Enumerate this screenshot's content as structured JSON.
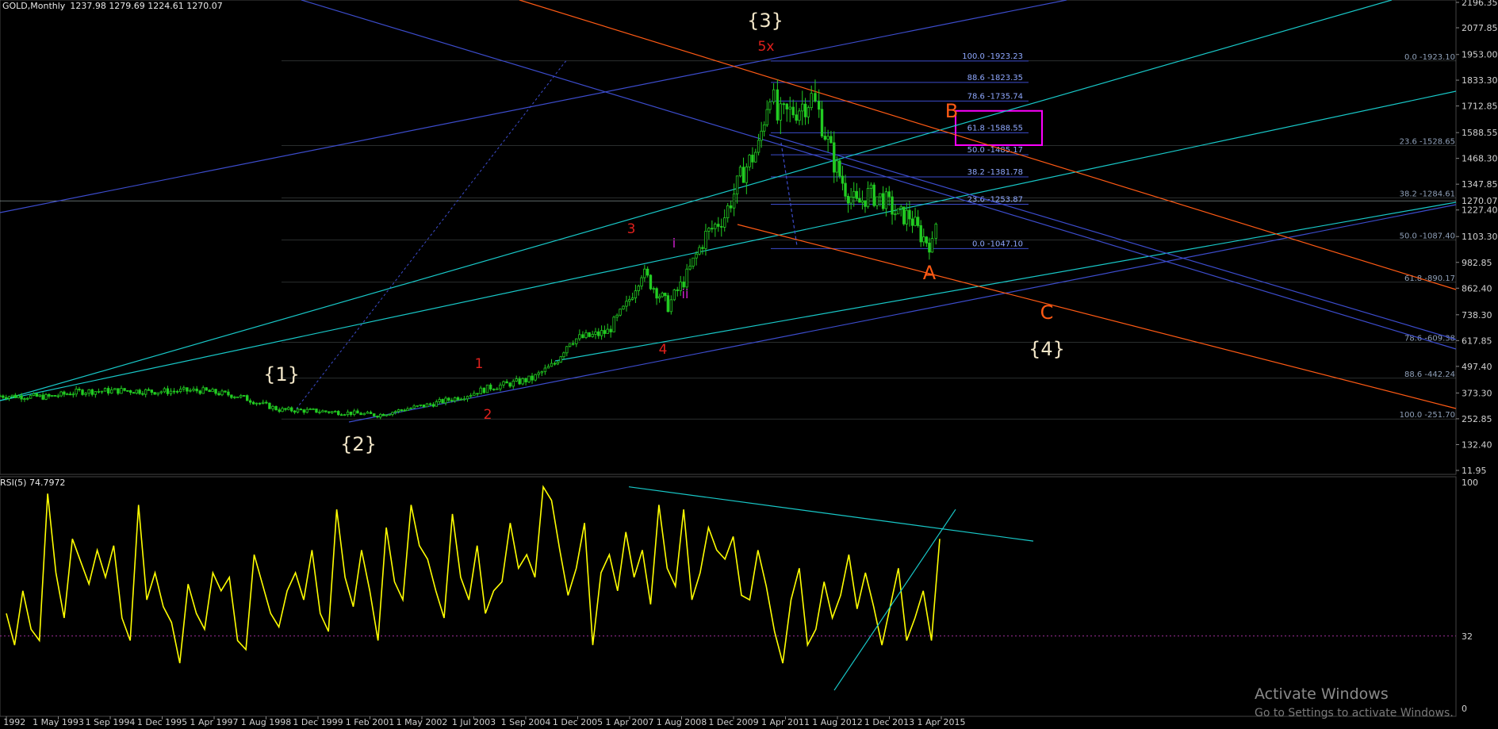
{
  "window": {
    "symbol_header": "GOLD,Monthly",
    "ohlc": "1237.98 1279.69 1224.61 1270.07"
  },
  "chart_data": [
    {
      "type": "candlestick",
      "name": "price-panel",
      "title": "GOLD,Monthly",
      "y_ticks": [
        "2196.35",
        "2077.85",
        "1953.00",
        "1833.30",
        "1712.85",
        "1588.55",
        "1468.30",
        "1347.85",
        "1227.40",
        "1103.30",
        "982.85",
        "862.40",
        "738.30",
        "617.85",
        "497.40",
        "373.30",
        "252.85",
        "132.40",
        "11.95"
      ],
      "last_price": "1270.07",
      "price_path": {
        "note_units": "date-year / USD",
        "x_years": [
          1991.2,
          1992.5,
          1993.3,
          1994.5,
          1995.3,
          1996.5,
          1997.5,
          1998.0,
          1998.6,
          1999.5,
          2000.5,
          2001.2,
          2002.0,
          2002.6,
          2003.5,
          2004.2,
          2004.8,
          2005.3,
          2005.9,
          2006.3,
          2006.9,
          2007.3,
          2007.8,
          2008.2,
          2008.6,
          2008.9,
          2009.4,
          2009.9,
          2010.4,
          2010.9,
          2011.3,
          2011.6,
          2011.8,
          2012.3,
          2012.7,
          2012.9,
          2013.3,
          2013.6,
          2013.9,
          2014.2,
          2014.6,
          2015.0,
          2015.3,
          2015.6,
          2015.9,
          2016.1
        ],
        "y_close": [
          360,
          355,
          380,
          385,
          380,
          385,
          360,
          330,
          295,
          290,
          280,
          270,
          300,
          320,
          360,
          400,
          420,
          440,
          510,
          620,
          640,
          660,
          780,
          940,
          850,
          780,
          920,
          1110,
          1200,
          1410,
          1520,
          1800,
          1650,
          1700,
          1750,
          1680,
          1450,
          1330,
          1250,
          1300,
          1280,
          1200,
          1200,
          1110,
          1060,
          1270
        ]
      },
      "fib_right": [
        {
          "label": "0.0 -1923.10",
          "price": 1923
        },
        {
          "label": "23.6 -1528.65",
          "price": 1528
        },
        {
          "label": "38.2 -1284.61",
          "price": 1284
        },
        {
          "label": "50.0 -1087.40",
          "price": 1087
        },
        {
          "label": "61.8 -890.17",
          "price": 890
        },
        {
          "label": "78.6 -609.38",
          "price": 609
        },
        {
          "label": "88.6 -442.24",
          "price": 442
        },
        {
          "label": "100.0 -251.70",
          "price": 252
        }
      ],
      "fib_inner": [
        {
          "label": "100.0 -1923.23",
          "price": 1923
        },
        {
          "label": "88.6 -1823.35",
          "price": 1823
        },
        {
          "label": "78.6 -1735.74",
          "price": 1736
        },
        {
          "label": "61.8 -1588.55",
          "price": 1588
        },
        {
          "label": "50.0 -1485.17",
          "price": 1485
        },
        {
          "label": "38.2 -1381.78",
          "price": 1382
        },
        {
          "label": "23.6 -1253.87",
          "price": 1254
        },
        {
          "label": "0.0 -1047.10",
          "price": 1047
        }
      ],
      "wave_labels": [
        {
          "text": "{1}",
          "color": "#f2e6c8"
        },
        {
          "text": "{2}",
          "color": "#f2e6c8"
        },
        {
          "text": "{3}",
          "color": "#f2e6c8"
        },
        {
          "text": "{4}",
          "color": "#f2e6c8"
        },
        {
          "text": "1",
          "color": "#e0201c"
        },
        {
          "text": "2",
          "color": "#e0201c"
        },
        {
          "text": "3",
          "color": "#e0201c"
        },
        {
          "text": "4",
          "color": "#e0201c"
        },
        {
          "text": "5x",
          "color": "#e0201c"
        },
        {
          "text": "i",
          "color": "#d020d0"
        },
        {
          "text": "ii",
          "color": "#d020d0"
        },
        {
          "text": "A",
          "color": "#ff5a14"
        },
        {
          "text": "B",
          "color": "#ff5a14"
        },
        {
          "text": "C",
          "color": "#ff5a14"
        }
      ],
      "colors": {
        "candles": "#22cc22",
        "channel_cyan": "#18c8c8",
        "channel_blue": "#3c4ccc",
        "channel_orange": "#ff5a14",
        "fib": "#3c4ccc",
        "highlight_box": "#ff00ff"
      }
    },
    {
      "type": "line",
      "name": "rsi-panel",
      "header": "RSI(5) 74.7972",
      "y_ticks": [
        "100",
        "32",
        "0"
      ],
      "level": 32,
      "series_color": "#ffff00",
      "values": [
        42,
        28,
        52,
        35,
        30,
        95,
        60,
        40,
        75,
        65,
        55,
        70,
        58,
        72,
        40,
        30,
        90,
        48,
        60,
        45,
        38,
        20,
        55,
        42,
        35,
        60,
        52,
        58,
        30,
        26,
        68,
        55,
        42,
        36,
        52,
        60,
        48,
        70,
        42,
        34,
        88,
        58,
        45,
        70,
        52,
        30,
        80,
        56,
        48,
        90,
        72,
        66,
        52,
        40,
        86,
        58,
        48,
        72,
        42,
        52,
        56,
        82,
        62,
        68,
        58,
        98,
        92,
        70,
        50,
        62,
        82,
        28,
        60,
        68,
        52,
        78,
        58,
        70,
        46,
        90,
        62,
        54,
        88,
        48,
        60,
        80,
        70,
        66,
        76,
        50,
        48,
        70,
        54,
        34,
        20,
        48,
        62,
        28,
        35,
        56,
        40,
        50,
        68,
        44,
        60,
        45,
        28,
        45,
        62,
        30,
        40,
        52,
        30,
        75
      ],
      "date_labels": [
        "Jan 1992",
        "1 May 1993",
        "1 Sep 1994",
        "1 Dec 1995",
        "1 Apr 1997",
        "1 Aug 1998",
        "1 Dec 1999",
        "1 Feb 2001",
        "1 May 2002",
        "1 Jul 2003",
        "1 Sep 2004",
        "1 Dec 2005",
        "1 Apr 2007",
        "1 Aug 2008",
        "1 Dec 2009",
        "1 Apr 2011",
        "1 Aug 2012",
        "1 Dec 2013",
        "1 Apr 2015"
      ]
    }
  ],
  "watermark": {
    "line1": "Activate Windows",
    "line2": "Go to Settings to activate Windows."
  }
}
